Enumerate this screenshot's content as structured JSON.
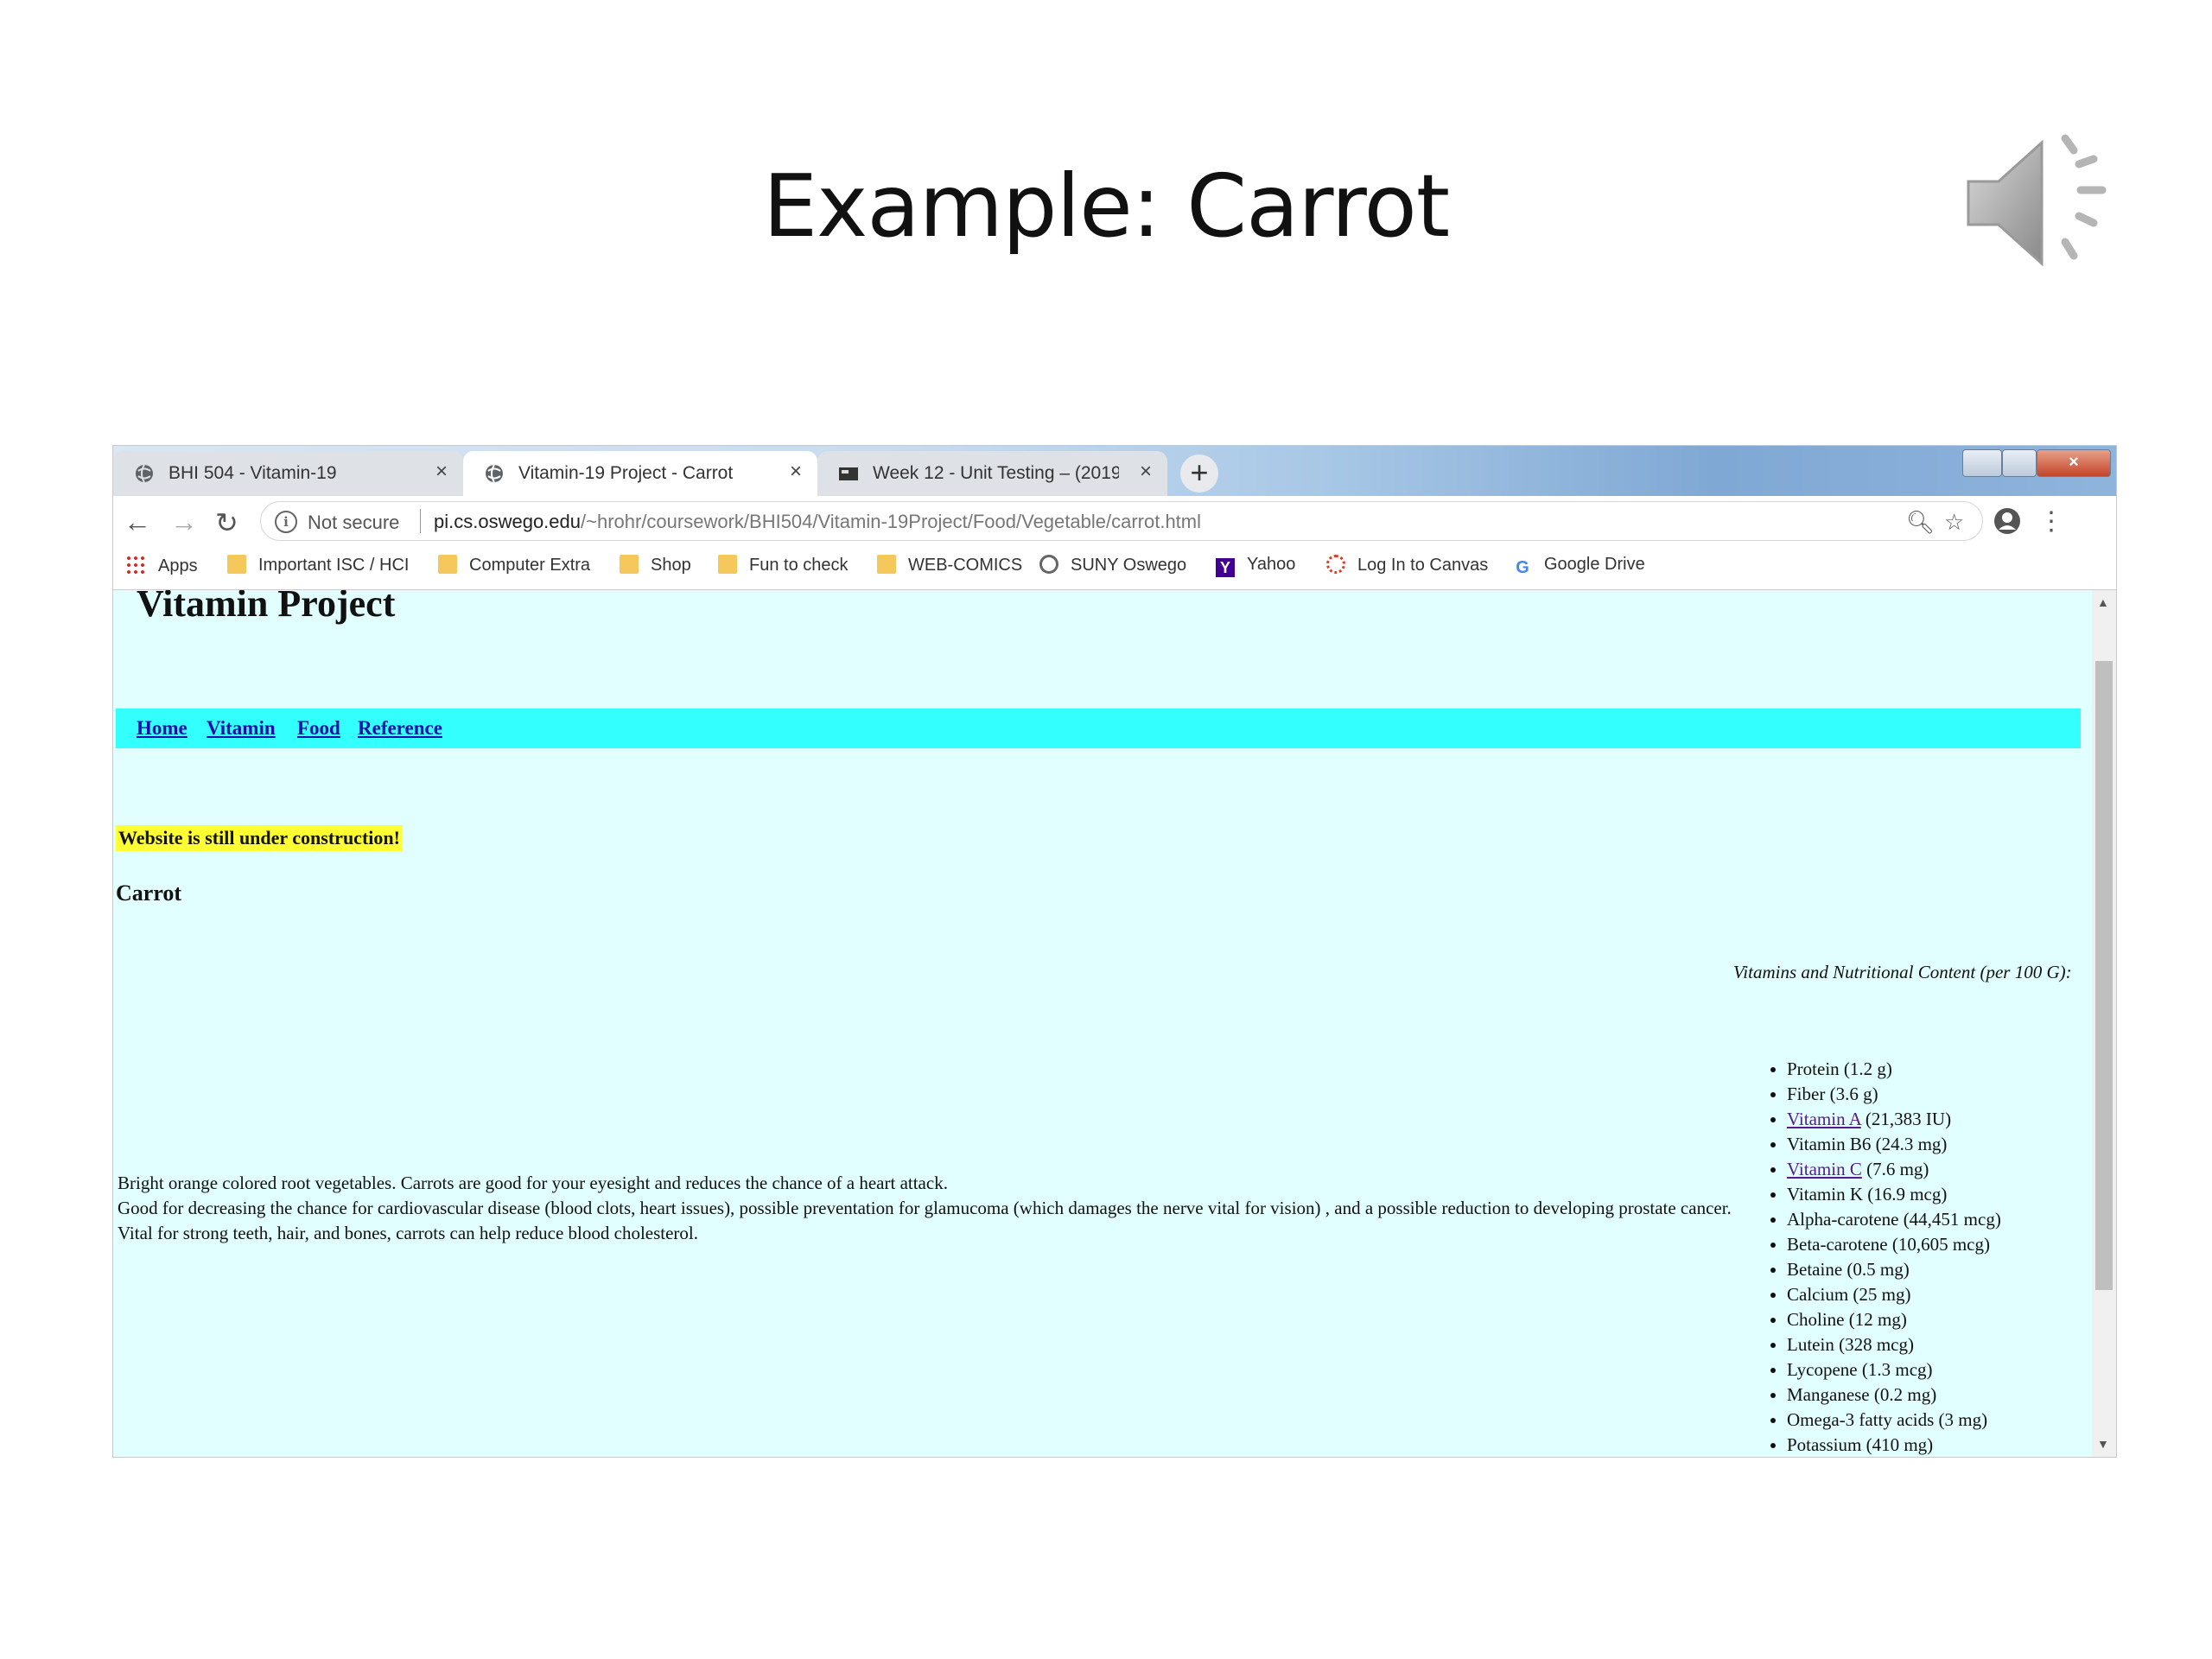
{
  "slide": {
    "title": "Example: Carrot"
  },
  "tabs": [
    {
      "label": "BHI 504 - Vitamin-19"
    },
    {
      "label": "Vitamin-19 Project - Carrot"
    },
    {
      "label": "Week 12 - Unit Testing – (20190"
    }
  ],
  "toolbar": {
    "security_label": "Not secure",
    "url_host": "pi.cs.oswego.edu",
    "url_path": "/~hrohr/coursework/BHI504/Vitamin-19Project/Food/Vegetable/carrot.html"
  },
  "bookmarks": [
    {
      "label": "Apps",
      "icon": "apps-grid-icon"
    },
    {
      "label": "Important ISC / HCI",
      "icon": "folder-icon"
    },
    {
      "label": "Computer Extra",
      "icon": "folder-icon"
    },
    {
      "label": "Shop",
      "icon": "folder-icon"
    },
    {
      "label": "Fun to check",
      "icon": "folder-icon"
    },
    {
      "label": "WEB-COMICS",
      "icon": "folder-icon"
    },
    {
      "label": "SUNY Oswego",
      "icon": "suny-oswego-icon"
    },
    {
      "label": "Yahoo",
      "icon": "yahoo-icon"
    },
    {
      "label": "Log In to Canvas",
      "icon": "canvas-icon"
    },
    {
      "label": "Google Drive",
      "icon": "google-icon"
    }
  ],
  "page": {
    "site_title": "Vitamin Project",
    "nav": [
      "Home",
      "Vitamin",
      "Food",
      "Reference"
    ],
    "construction_notice": "Website is still under construction!",
    "heading": "Carrot",
    "description": [
      "Bright orange colored root vegetables. Carrots are good for your eyesight and reduces the chance of a heart attack.",
      "Good for decreasing the chance for cardiovascular disease (blood clots, heart issues), possible preventation for glamucoma (which damages the nerve vital for vision) , and a possible reduction to developing prostate cancer.",
      "Vital for strong teeth, hair, and bones, carrots can help reduce blood cholesterol."
    ],
    "nutrition_heading": "Vitamins and Nutritional Content (per 100 G):",
    "nutrition": [
      {
        "name": "Protein",
        "amount": " (1.2 g)"
      },
      {
        "name": "Fiber",
        "amount": " (3.6 g)"
      },
      {
        "name": "Vitamin A",
        "amount": " (21,383 IU)"
      },
      {
        "name": "Vitamin B6",
        "amount": " (24.3 mg)"
      },
      {
        "name": "Vitamin C",
        "amount": " (7.6 mg)"
      },
      {
        "name": "Vitamin K",
        "amount": " (16.9 mcg)"
      },
      {
        "name": "Alpha-carotene",
        "amount": " (44,451 mcg)"
      },
      {
        "name": "Beta-carotene",
        "amount": " (10,605 mcg)"
      },
      {
        "name": "Betaine",
        "amount": " (0.5 mg)"
      },
      {
        "name": "Calcium",
        "amount": " (25 mg)"
      },
      {
        "name": "Choline",
        "amount": " (12 mg)"
      },
      {
        "name": "Lutein",
        "amount": " (328 mcg)"
      },
      {
        "name": "Lycopene",
        "amount": " (1.3 mcg)"
      },
      {
        "name": "Manganese",
        "amount": " (0.2 mg)"
      },
      {
        "name": "Omega-3 fatty acids",
        "amount": " (3 mg)"
      },
      {
        "name": "Potassium",
        "amount": " (410 mg)"
      }
    ]
  },
  "colors": {
    "page_background": "#e2ffff",
    "nav_bar": "#33ffff",
    "construction_highlight": "#ffff33",
    "link": "#1a0dab",
    "visited_link": "#551a8b"
  }
}
